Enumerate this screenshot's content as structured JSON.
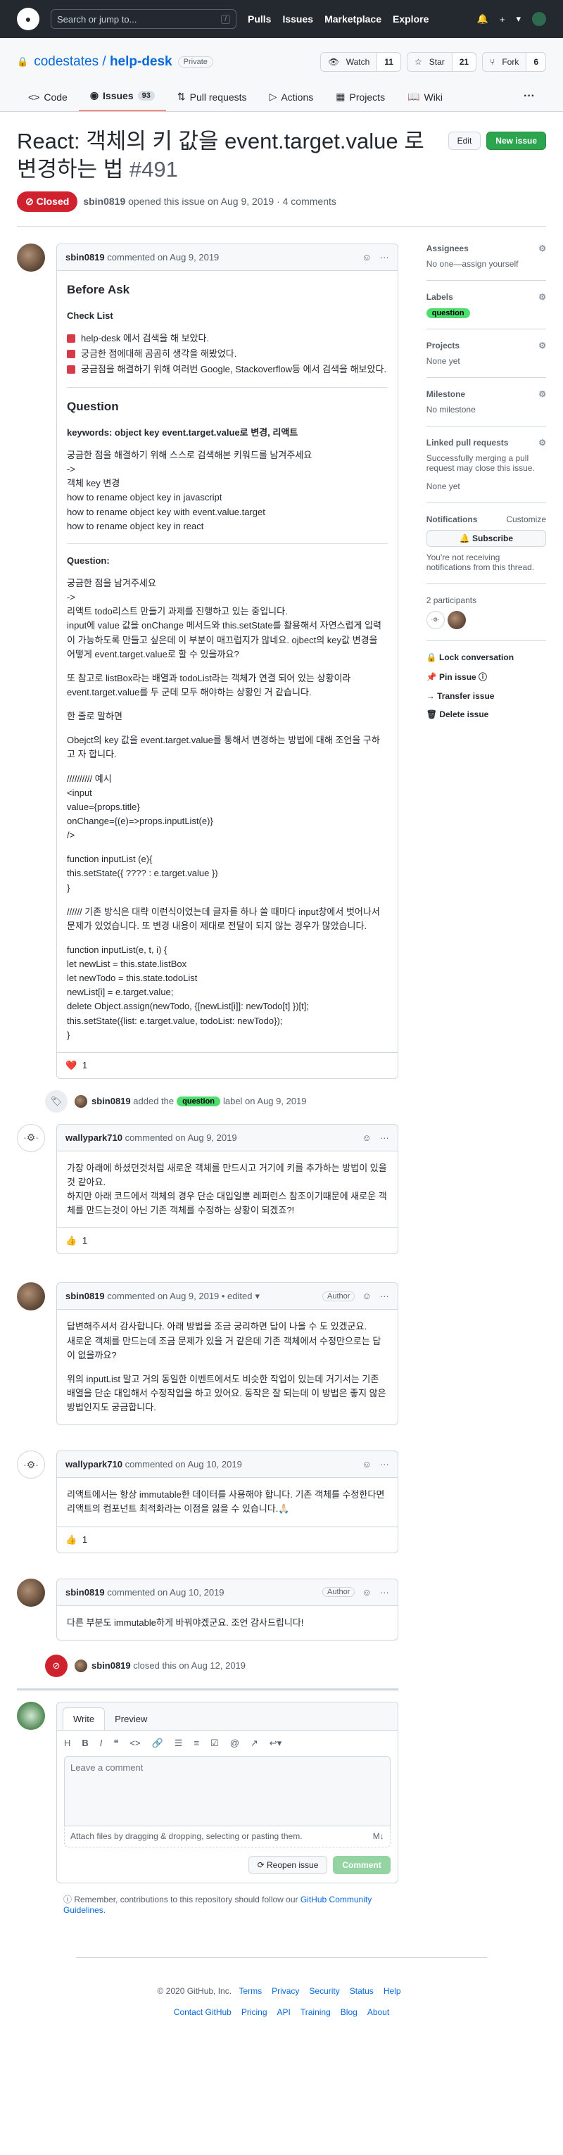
{
  "topnav": {
    "search_placeholder": "Search or jump to...",
    "slash": "/",
    "links": [
      "Pulls",
      "Issues",
      "Marketplace",
      "Explore"
    ],
    "plus": "+",
    "caret": "▾"
  },
  "repo": {
    "owner": "codestates",
    "sep": " / ",
    "name": "help-desk",
    "visibility": "Private",
    "watch": {
      "label": "Watch",
      "count": "11"
    },
    "star": {
      "label": "Star",
      "count": "21"
    },
    "fork": {
      "label": "Fork",
      "count": "6"
    },
    "tabs": [
      {
        "label": "Code"
      },
      {
        "label": "Issues",
        "count": "93"
      },
      {
        "label": "Pull requests"
      },
      {
        "label": "Actions"
      },
      {
        "label": "Projects"
      },
      {
        "label": "Wiki"
      }
    ],
    "more": "···"
  },
  "issue": {
    "title": "React: 객체의 키 값을 event.target.value 로 변경하는 법",
    "number": "#491",
    "edit_label": "Edit",
    "new_issue_label": "New issue",
    "state": "Closed",
    "author": "sbin0819",
    "opened_text": "opened this issue on Aug 9, 2019 · 4 comments"
  },
  "comments": [
    {
      "author": "sbin0819",
      "when": "commented on Aug 9, 2019",
      "h_before": "Before Ask",
      "h_checklist": "Check List",
      "checks": [
        "help-desk 에서 검색을 해 보았다.",
        "궁금한 점에대해 곰곰히 생각을 해봤었다.",
        "궁금점을 해결하기 위해 여러번 Google, Stackoverflow등 에서 검색을 해보았다."
      ],
      "h_question": "Question",
      "keywords": "keywords: object key event.target.value로 변경, 리액트",
      "p1": [
        "궁금한 점을 해결하기 위해 스스로 검색해본 키워드를 남겨주세요",
        "->",
        "객체 key 변경",
        "how to rename object key in javascript",
        "how to rename object key with event.value.target",
        "how to rename object key in react"
      ],
      "h_question2": "Question:",
      "p2": [
        "궁금한 점을 남겨주세요",
        "->",
        "리액트 todo리스트 만들기 과제를 진행하고 있는 중입니다.",
        "input에 value 값을 onChange 메서드와 this.setState를 활용해서 자연스럽게 입력이 가능하도록 만들고 싶은데 이 부분이 매끄럽지가 않네요. ojbect의 key값 변경을 어떻게 event.target.value로 할 수 있을까요?"
      ],
      "p3": "또 참고로 listBox라는 배열과 todoList라는 객체가 연결 되어 있는 상황이라 event.target.value를 두 군데 모두 해야하는 상황인 거 같습니다.",
      "p4": "한 줄로 말하면",
      "p5": "Obejct의 key 값을 event.target.value를 통해서 변경하는 방법에 대해 조언을 구하고 자 합니다.",
      "p6": [
        "////////// 예시",
        "<input",
        "value={props.title}",
        "onChange={(e)=>props.inputList(e)}",
        "/>"
      ],
      "p7": [
        "function inputList (e){",
        "this.setState({ ???? : e.target.value })",
        "}"
      ],
      "p8": "////// 기존 방식은 대략 이런식이었는데 글자를 하나 쓸 때마다 input창에서 벗어나서 문제가 있었습니다. 또 변경 내용이 제대로 전달이 되지 않는 경우가 많았습니다.",
      "p9": [
        "function inputList(e, t, i) {",
        "let newList = this.state.listBox",
        "let newTodo = this.state.todoList",
        "newList[i] = e.target.value;",
        "delete Object.assign(newTodo, {[newList[i]]: newTodo[t] })[t];",
        "this.setState({list: e.target.value, todoList: newTodo});",
        "}"
      ],
      "reaction": "❤️",
      "reaction_count": "1"
    },
    {
      "author": "wallypark710",
      "when": "commented on Aug 9, 2019",
      "body": [
        "가장 아래에 하셨던것처럼 새로운 객체를 만드시고 거기에 키를 추가하는 방법이 있을것 같아요.",
        "하지만 아래 코드에서 객체의 경우 단순 대입일뿐 레퍼런스 참조이기때문에 새로운 객체를 만드는것이 아닌 기존 객체를 수정하는 상황이 되겠죠?!"
      ],
      "reaction": "👍",
      "reaction_count": "1"
    },
    {
      "author": "sbin0819",
      "when": "commented on Aug 9, 2019 • edited",
      "badge": "Author",
      "body": [
        "답변해주셔서 감사합니다. 아래 방법을 조금 궁리하면 답이 나올 수 도 있겠군요.",
        "새로운 객체를 만드는데 조금 문제가 있을 거 같은데 기존 객체에서 수정만으로는 답이 없을까요?"
      ],
      "body2": "위의 inputList 말고 거의 동일한 이벤트에서도 비슷한 작업이 있는데 거기서는 기존 배열을 단순 대입해서 수정작업을 하고 있어요. 동작은 잘 되는데 이 방법은 좋지 않은 방법인지도 궁금합니다."
    },
    {
      "author": "wallypark710",
      "when": "commented on Aug 10, 2019",
      "body": "리액트에서는 항상 immutable한 데이터를 사용해야 합니다. 기존 객체를 수정한다면 리액트의 컴포넌트 최적화라는 이점을 잃을 수 있습니다.🙏🏻",
      "reaction": "👍",
      "reaction_count": "1"
    },
    {
      "author": "sbin0819",
      "when": "commented on Aug 10, 2019",
      "badge": "Author",
      "body": "다른 부분도 immutable하게 바꿔야겠군요. 조언 감사드립니다!"
    }
  ],
  "events": {
    "label_event": {
      "author": "sbin0819",
      "before": "added the",
      "label": "question",
      "after": "label on Aug 9, 2019"
    },
    "closed_event": {
      "author": "sbin0819",
      "text": "closed this on Aug 12, 2019"
    }
  },
  "new_comment": {
    "write_tab": "Write",
    "preview_tab": "Preview",
    "placeholder": "Leave a comment",
    "attach_text": "Attach files by dragging & dropping, selecting or pasting them.",
    "markdown": "M↓",
    "reopen_label": "Reopen issue",
    "comment_label": "Comment",
    "note": "Remember, contributions to this repository should follow our",
    "note_link": "GitHub Community Guidelines",
    "note_end": "."
  },
  "sidebar": {
    "assignees": {
      "title": "Assignees",
      "value": "No one—assign yourself"
    },
    "labels": {
      "title": "Labels",
      "value": "question"
    },
    "projects": {
      "title": "Projects",
      "value": "None yet"
    },
    "milestone": {
      "title": "Milestone",
      "value": "No milestone"
    },
    "linked": {
      "title": "Linked pull requests",
      "desc": "Successfully merging a pull request may close this issue.",
      "value": "None yet"
    },
    "notifications": {
      "title": "Notifications",
      "customize": "Customize",
      "subscribe": "Subscribe",
      "desc": "You're not receiving notifications from this thread."
    },
    "participants": "2 participants",
    "actions": [
      "Lock conversation",
      "Pin issue",
      "Transfer issue",
      "Delete issue"
    ]
  },
  "footer": {
    "copyright": "© 2020 GitHub, Inc.",
    "row1": [
      "Terms",
      "Privacy",
      "Security",
      "Status",
      "Help"
    ],
    "row2": [
      "Contact GitHub",
      "Pricing",
      "API",
      "Training",
      "Blog",
      "About"
    ]
  }
}
